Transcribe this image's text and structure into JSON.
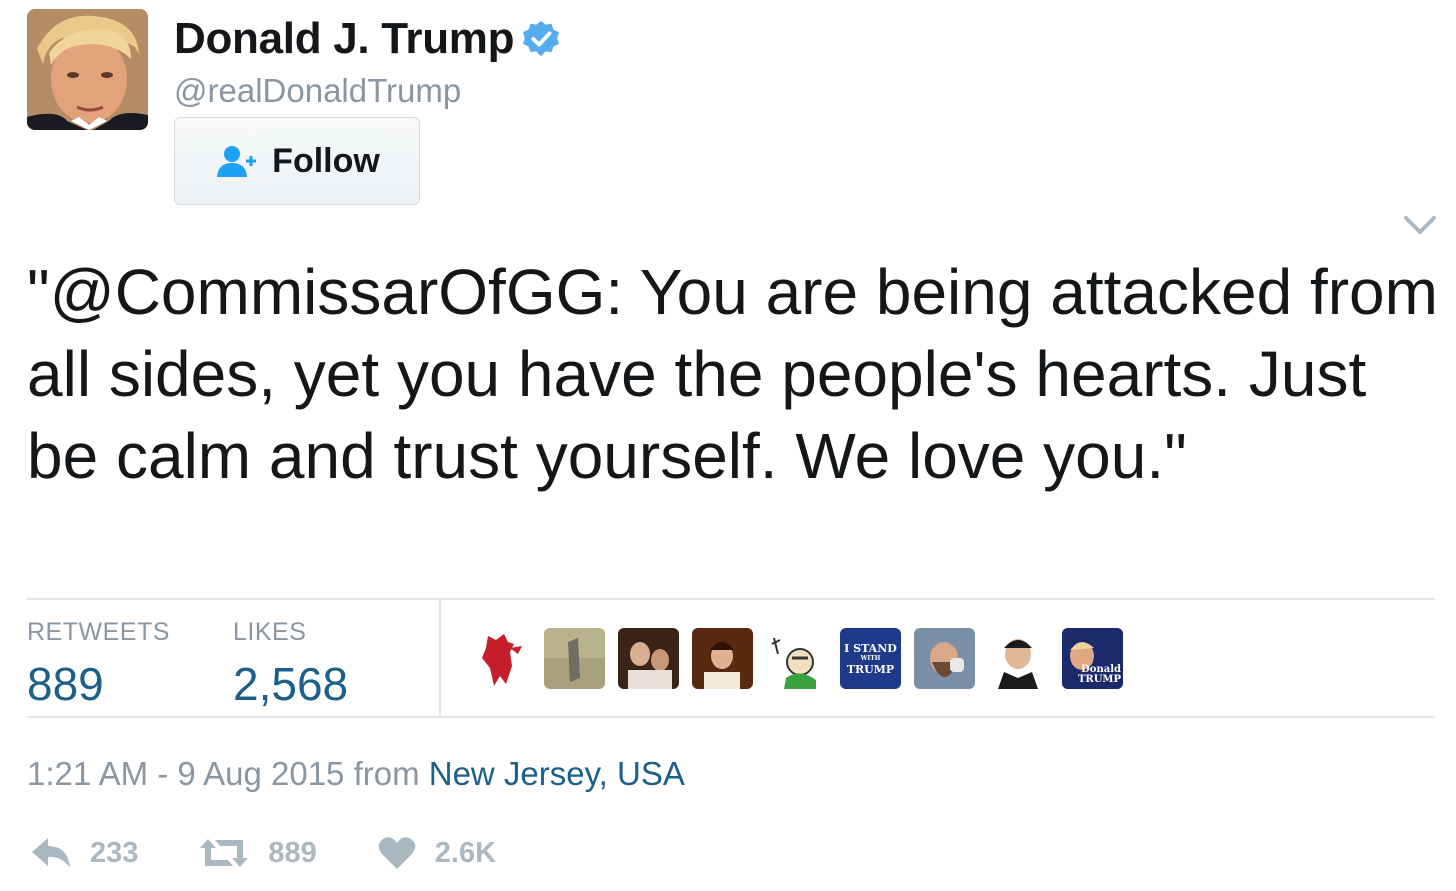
{
  "user": {
    "display_name": "Donald J. Trump",
    "handle": "@realDonaldTrump",
    "verified": true
  },
  "follow_button": {
    "label": "Follow"
  },
  "tweet": {
    "text": "\"@CommissarOfGG: You are being attacked from all sides, yet you have the people's hearts. Just be calm and trust yourself. We love you.\""
  },
  "stats": {
    "retweets_label": "RETWEETS",
    "retweets_value": "889",
    "likes_label": "LIKES",
    "likes_value": "2,568"
  },
  "likers": [
    {
      "name": "liker-1",
      "badge": ""
    },
    {
      "name": "liker-2",
      "badge": ""
    },
    {
      "name": "liker-3",
      "badge": ""
    },
    {
      "name": "liker-4",
      "badge": ""
    },
    {
      "name": "liker-5",
      "badge": ""
    },
    {
      "name": "liker-6",
      "badge_line1": "I STAND",
      "badge_line2": "WITH",
      "badge_line3": "TRUMP"
    },
    {
      "name": "liker-7",
      "badge": ""
    },
    {
      "name": "liker-8",
      "badge": ""
    },
    {
      "name": "liker-9",
      "badge_line1": "Donald",
      "badge_line2": "TRUMP"
    }
  ],
  "meta": {
    "time": "1:21 AM - 9 Aug 2015",
    "from_word": "from",
    "location": "New Jersey, USA"
  },
  "actions": {
    "reply_count": "233",
    "retweet_count": "889",
    "like_count": "2.6K"
  },
  "colors": {
    "link": "#1b5f8a",
    "muted": "#8a97a2",
    "verified_blue": "#55acee",
    "follow_blue": "#1da1f2",
    "action_grey": "#aab8c2",
    "divider": "#e1e8ed"
  }
}
